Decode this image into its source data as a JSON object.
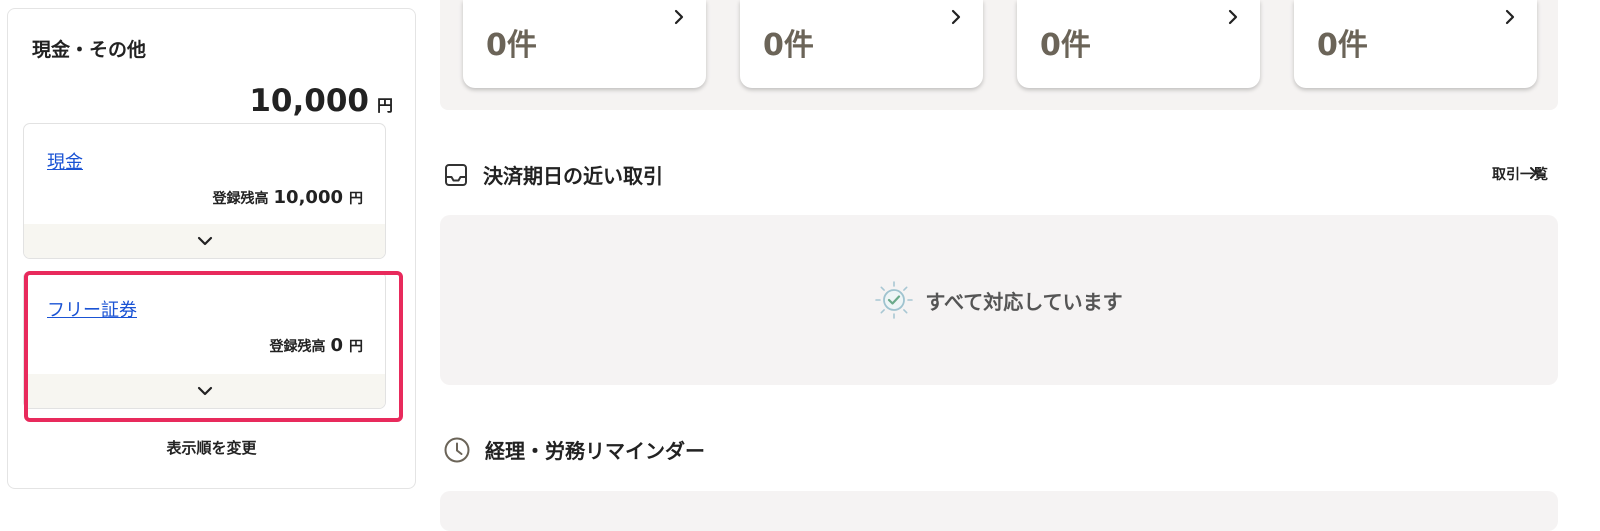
{
  "left_panel": {
    "title": "現金・その他",
    "total_amount": "10,000",
    "total_unit": "円",
    "accounts": [
      {
        "name": "現金",
        "balance_label": "登録残高",
        "balance": "10,000",
        "unit": "円"
      },
      {
        "name": "フリー証券",
        "balance_label": "登録残高",
        "balance": "0",
        "unit": "円"
      }
    ],
    "reorder_label": "表示順を変更"
  },
  "status_cards": [
    {
      "count": "0件"
    },
    {
      "count": "0件"
    },
    {
      "count": "0件"
    },
    {
      "count": "0件"
    }
  ],
  "due_section": {
    "title": "決済期日の近い取引",
    "list_link": "取引一覧",
    "empty_message": "すべて対応しています"
  },
  "reminder_section": {
    "title": "経理・労務リマインダー"
  },
  "colors": {
    "link_blue": "#1a53d4",
    "highlight_pink": "#e82a5c",
    "count_brown": "#6b6458",
    "panel_gray": "#f5f3f3"
  }
}
